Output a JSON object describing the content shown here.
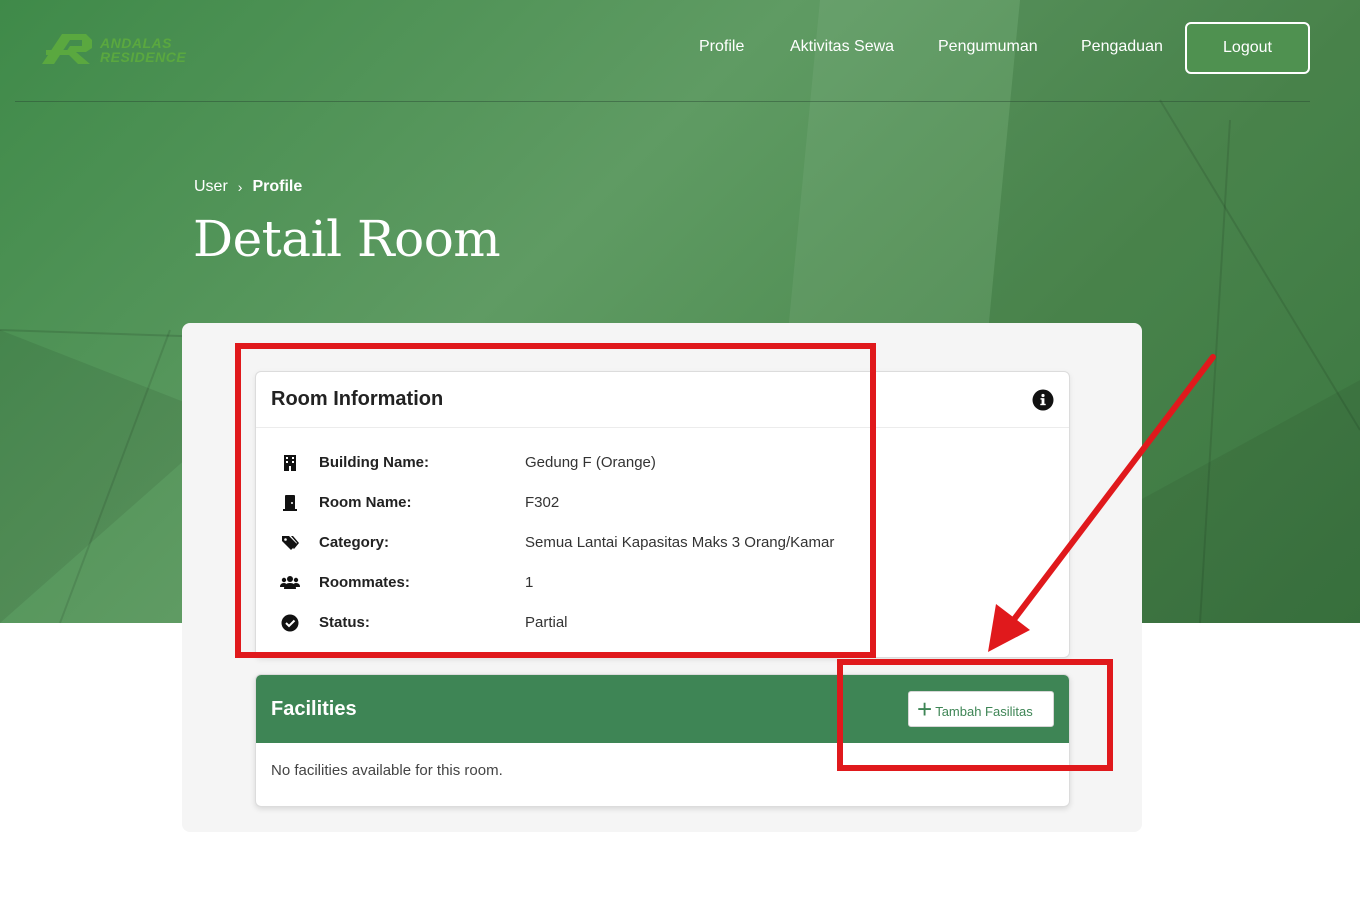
{
  "brand": {
    "line1": "ANDALAS",
    "line2": "RESIDENCE"
  },
  "nav": {
    "items": [
      {
        "label": "Profile"
      },
      {
        "label": "Aktivitas Sewa"
      },
      {
        "label": "Pengumuman"
      },
      {
        "label": "Pengaduan"
      }
    ],
    "logout_label": "Logout"
  },
  "breadcrumb": {
    "root": "User",
    "separator": "›",
    "current": "Profile"
  },
  "page": {
    "title": "Detail Room"
  },
  "room_info": {
    "title": "Room Information",
    "rows": [
      {
        "icon": "building-icon",
        "label": "Building Name:",
        "value": "Gedung F (Orange)"
      },
      {
        "icon": "door-icon",
        "label": "Room Name:",
        "value": "F302"
      },
      {
        "icon": "tags-icon",
        "label": "Category:",
        "value": "Semua Lantai Kapasitas Maks 3 Orang/Kamar"
      },
      {
        "icon": "users-icon",
        "label": "Roommates:",
        "value": "1"
      },
      {
        "icon": "check-circle-icon",
        "label": "Status:",
        "value": "Partial"
      }
    ]
  },
  "facilities": {
    "title": "Facilities",
    "add_label": "Tambah Fasilitas",
    "empty_text": "No facilities available for this room."
  },
  "colors": {
    "hero_green": "#4f9150",
    "facilities_header": "#3e8555",
    "annotation_red": "#e0191c"
  }
}
